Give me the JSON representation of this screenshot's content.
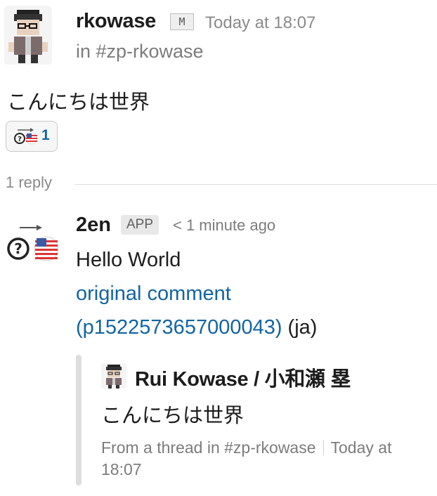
{
  "parent_message": {
    "author": "rkowase",
    "author_badge": "M",
    "timestamp": "Today at 18:07",
    "channel": "in #zp-rkowase",
    "text": "こんにちは世界",
    "avatar_icon": "pixel-art-person-avatar",
    "reaction": {
      "icon": "translate-us-flag-emoji",
      "count": "1"
    }
  },
  "replies": {
    "label": "1 reply"
  },
  "reply": {
    "author": "2en",
    "app_badge": "APP",
    "timestamp": "< 1 minute ago",
    "avatar_icon": "question-mark-us-flag-avatar",
    "line1": "Hello World",
    "link_text": "original comment",
    "link_id": "(p1522573657000043)",
    "lang_suffix": " (ja)",
    "quote": {
      "author": "Rui Kowase / 小和瀬 塁",
      "text": "こんにちは世界",
      "footer_channel": "From a thread in #zp-rkowase",
      "footer_time": "Today at 18:07"
    }
  },
  "colors": {
    "link": "#1264a3",
    "text": "#1d1c1d",
    "muted": "#7c7c7c",
    "divider": "#dddddd"
  }
}
